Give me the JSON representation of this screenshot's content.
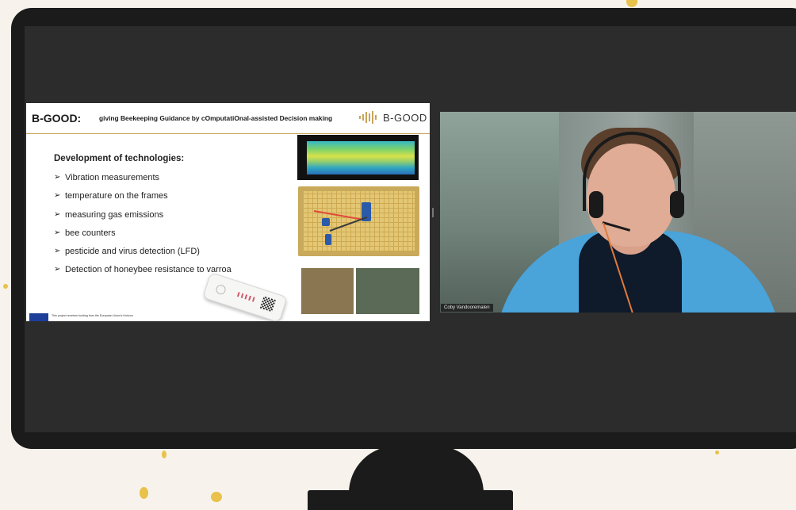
{
  "slide": {
    "title": "B-GOOD:",
    "subtitle": "giving Beekeeping Guidance by cOmputatiOnal-assisted Decision making",
    "logo_text": "B-GOOD",
    "heading": "Development of technologies:",
    "bullets": [
      "Vibration measurements",
      "temperature on the frames",
      "measuring gas emissions",
      "bee counters",
      "pesticide and virus detection (LFD)",
      "Detection of honeybee resistance to varroa"
    ],
    "footer_note": "This project receives funding from the European Union's Horizon"
  },
  "video": {
    "participant_name": "Coby Vandooremalen"
  },
  "colors": {
    "accent": "#c7a45a",
    "speck": "#e8c24a",
    "monitor": "#1b1b1b"
  }
}
